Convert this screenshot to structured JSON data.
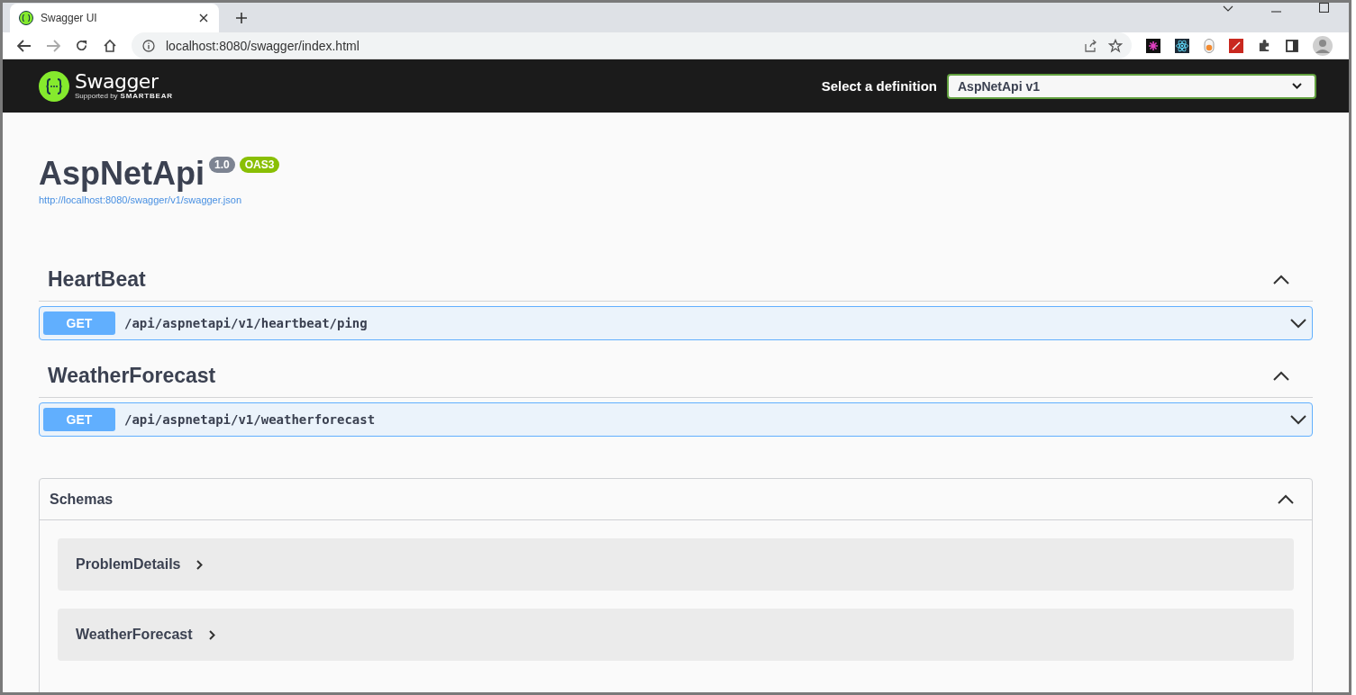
{
  "browser": {
    "tabs": [
      {
        "title": "Swagger UI",
        "selected": true
      }
    ],
    "address": "localhost:8080/swagger/index.html"
  },
  "topbar": {
    "logo_text": "Swagger",
    "logo_subtext": "Supported by",
    "logo_brand": "SMARTBEAR",
    "definition_label": "Select a definition",
    "definition_value": "AspNetApi v1"
  },
  "info": {
    "title": "AspNetApi",
    "version": "1.0",
    "oas": "OAS3",
    "url": "http://localhost:8080/swagger/v1/swagger.json"
  },
  "tags": [
    {
      "name": "HeartBeat",
      "expanded": true,
      "operations": [
        {
          "method": "GET",
          "path": "/api/aspnetapi/v1/heartbeat/ping",
          "expanded": false
        }
      ]
    },
    {
      "name": "WeatherForecast",
      "expanded": true,
      "operations": [
        {
          "method": "GET",
          "path": "/api/aspnetapi/v1/weatherforecast",
          "expanded": false
        }
      ]
    }
  ],
  "schemas": {
    "title": "Schemas",
    "expanded": true,
    "items": [
      {
        "name": "ProblemDetails",
        "expanded": false
      },
      {
        "name": "WeatherForecast",
        "expanded": false
      }
    ]
  }
}
